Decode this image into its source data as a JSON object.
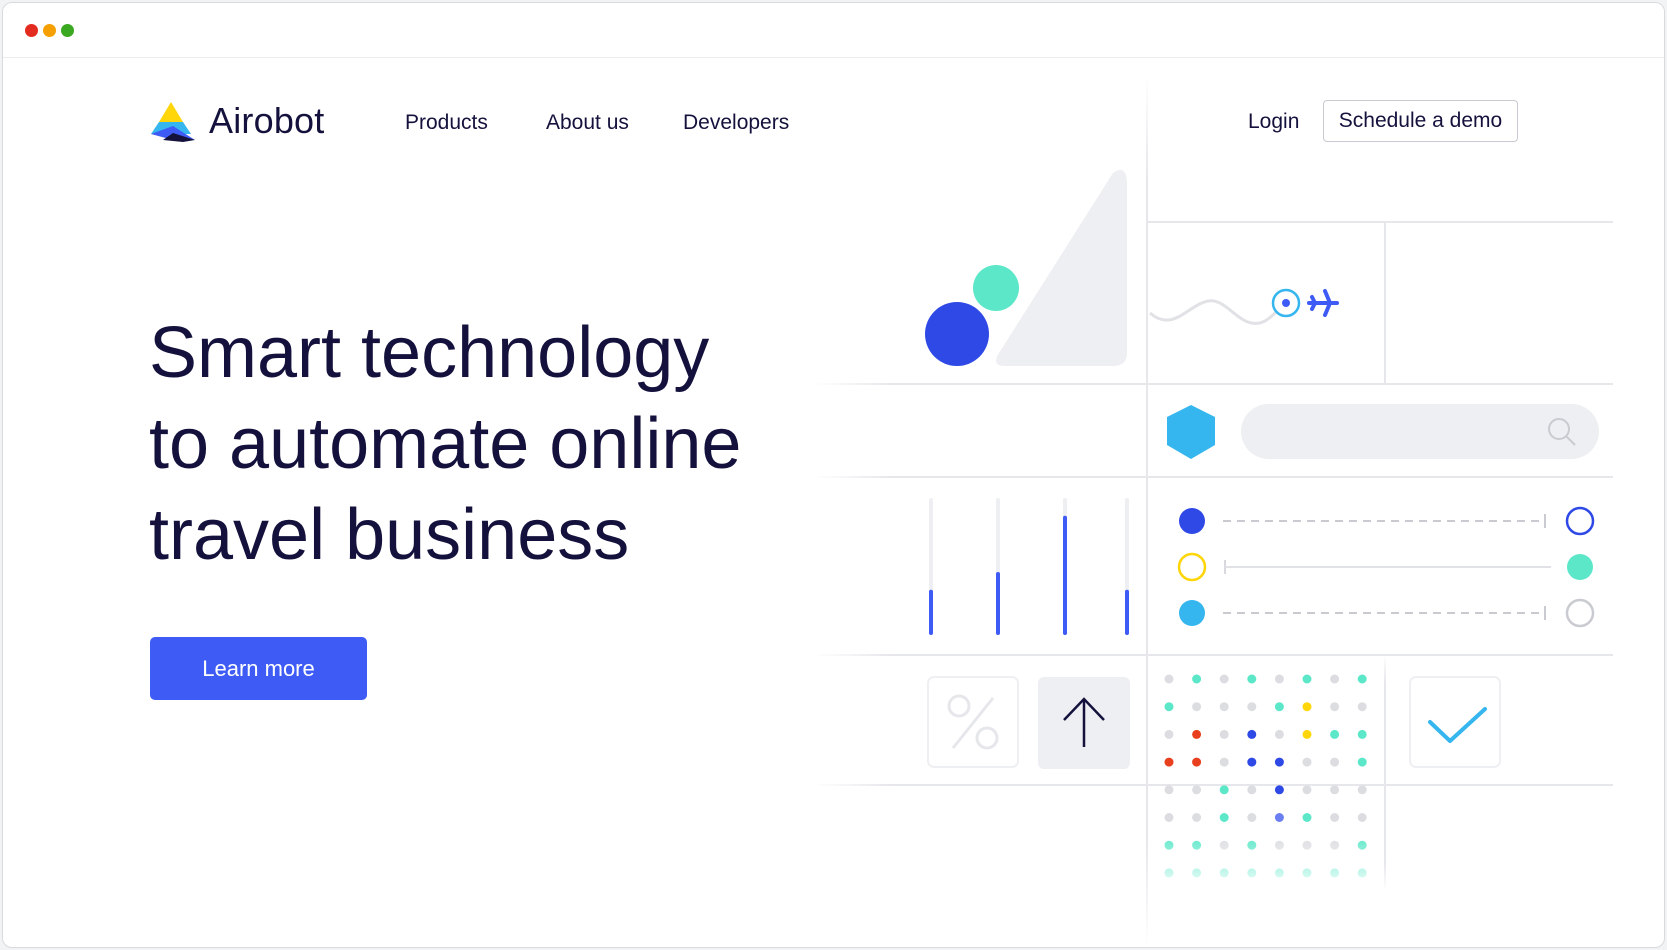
{
  "window": {
    "controls": [
      "close",
      "minimize",
      "maximize"
    ]
  },
  "brand": {
    "name": "Airobot",
    "colors": {
      "primary": "#3e5cf5",
      "dark": "#14123d",
      "teal": "#5ce8c8",
      "sky": "#35b6ef",
      "yellow": "#ffd60a",
      "red": "#e8401f"
    }
  },
  "nav": {
    "items": [
      {
        "label": "Products"
      },
      {
        "label": "About us"
      },
      {
        "label": "Developers"
      }
    ]
  },
  "header": {
    "login_label": "Login",
    "demo_label": "Schedule a demo"
  },
  "hero": {
    "lines": [
      "Smart technology",
      "to automate online",
      "travel business"
    ],
    "cta_label": "Learn more"
  },
  "illustration": {
    "icons": [
      "triangle-shape",
      "blue-circle",
      "teal-circle",
      "flight-path",
      "location-pin-icon",
      "airplane-icon",
      "hexagon-shape",
      "search-bar",
      "search-icon",
      "percent-icon",
      "arrow-up-icon",
      "checkmark-icon",
      "dot-matrix"
    ],
    "bar_levels": [
      0.33,
      0.46,
      0.87,
      0.33
    ],
    "connections": [
      {
        "left": "filled-blue",
        "line": "dashed",
        "right": "outline-blue"
      },
      {
        "left": "outline-yellow",
        "line": "solid",
        "right": "filled-teal"
      },
      {
        "left": "filled-sky",
        "line": "dashed",
        "right": "outline-grey"
      }
    ]
  }
}
